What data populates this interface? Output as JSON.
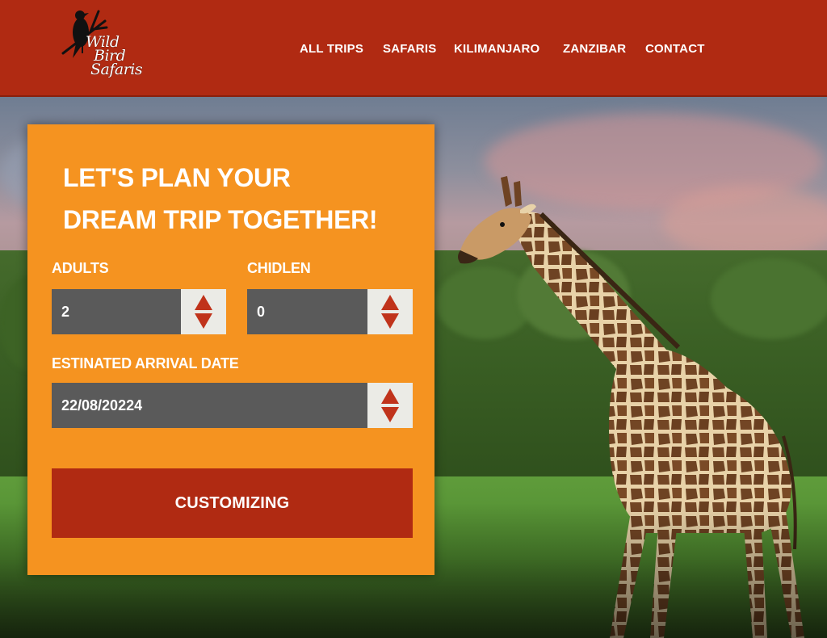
{
  "brand": {
    "logo_line1": "Wild",
    "logo_line2": "Bird",
    "logo_line3": "Safaris"
  },
  "nav": {
    "items": [
      "ALL TRIPS",
      "SAFARIS",
      "KILIMANJARO",
      "ZANZIBAR",
      "CONTACT"
    ]
  },
  "planner": {
    "title_line1": "LET'S PLAN YOUR",
    "title_line2": "DREAM TRIP TOGETHER!",
    "adults_label": "ADULTS",
    "adults_value": "2",
    "children_label": "CHIDLEN",
    "children_value": "0",
    "date_label": "ESTINATED ARRIVAL DATE",
    "date_value": "22/08/20224",
    "submit_label": "CUSTOMIZING"
  },
  "colors": {
    "header_bg": "#b02a12",
    "panel_bg": "#f59320",
    "field_bg": "#5a5a5a",
    "spinner_bg": "#ebebe6",
    "spinner_arrow": "#c0331b",
    "button_bg": "#b02a12"
  },
  "icons": {
    "logo": "bird-on-branch-icon",
    "spinner": "up-down-arrows-icon"
  }
}
